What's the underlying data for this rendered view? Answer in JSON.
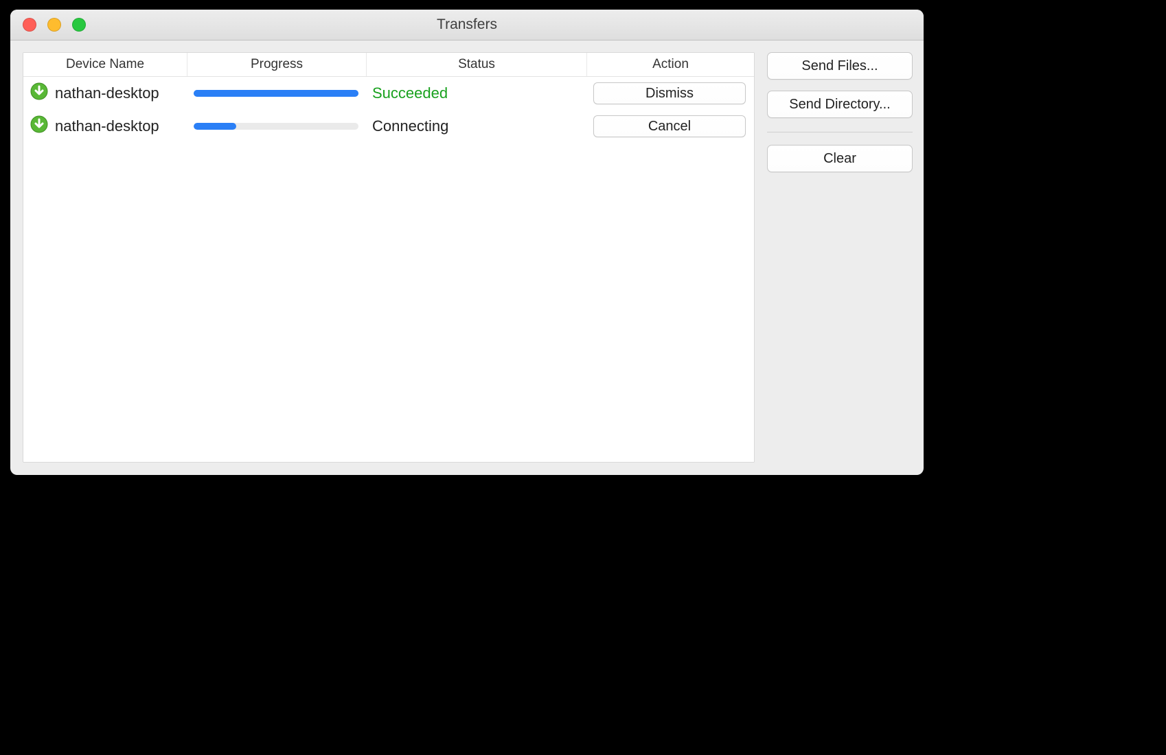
{
  "window": {
    "title": "Transfers"
  },
  "table": {
    "headers": {
      "device": "Device Name",
      "progress": "Progress",
      "status": "Status",
      "action": "Action"
    },
    "rows": [
      {
        "device": "nathan-desktop",
        "progress_pct": 100,
        "status": "Succeeded",
        "status_style": "succeeded",
        "action_label": "Dismiss"
      },
      {
        "device": "nathan-desktop",
        "progress_pct": 26,
        "status": "Connecting",
        "status_style": "default",
        "action_label": "Cancel"
      }
    ]
  },
  "sidepanel": {
    "send_files_label": "Send Files...",
    "send_directory_label": "Send Directory...",
    "clear_label": "Clear"
  },
  "colors": {
    "progress_bar": "#2a7ff6",
    "status_succeeded": "#19a11e"
  }
}
